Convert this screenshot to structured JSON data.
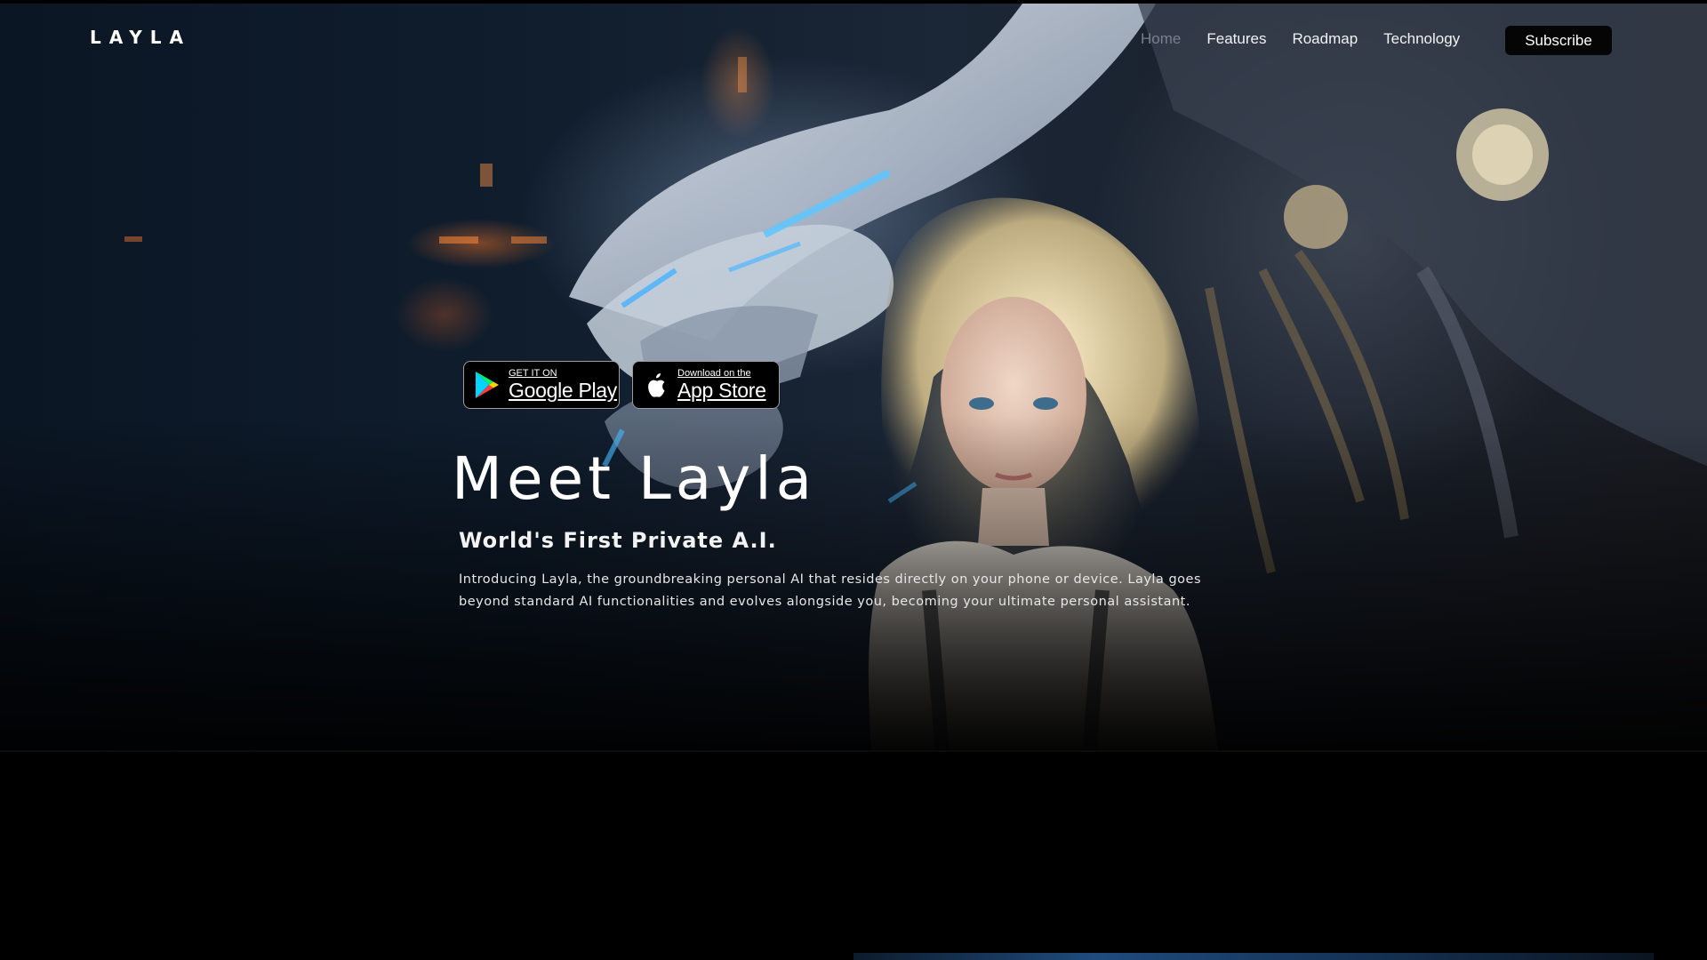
{
  "header": {
    "logo": "LAYLA",
    "nav": [
      {
        "label": "Home",
        "active": true
      },
      {
        "label": "Features",
        "active": false
      },
      {
        "label": "Roadmap",
        "active": false
      },
      {
        "label": "Technology",
        "active": false
      }
    ],
    "subscribe_label": "Subscribe"
  },
  "hero": {
    "badges": {
      "google": {
        "small": "GET IT ON",
        "large": "Google Play",
        "icon": "google-play-icon"
      },
      "apple": {
        "small": "Download on the",
        "large": "App Store",
        "icon": "apple-icon"
      }
    },
    "title": "Meet Layla",
    "subtitle": "World's First Private A.I.",
    "description": "Introducing Layla, the groundbreaking personal AI that resides directly on your phone or device. Layla goes beyond standard AI functionalities and evolves alongside you, becoming your ultimate personal assistant."
  },
  "colors": {
    "background": "#000000",
    "nav_active": "#7a7f88",
    "text": "#ffffff"
  }
}
